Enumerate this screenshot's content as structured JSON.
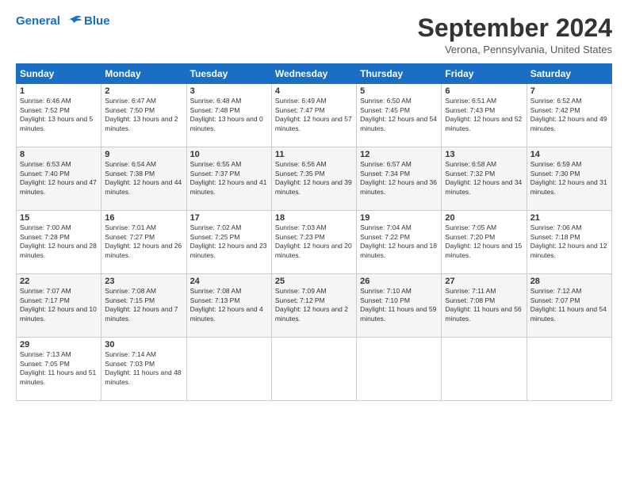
{
  "logo": {
    "line1": "General",
    "line2": "Blue"
  },
  "title": "September 2024",
  "location": "Verona, Pennsylvania, United States",
  "days_of_week": [
    "Sunday",
    "Monday",
    "Tuesday",
    "Wednesday",
    "Thursday",
    "Friday",
    "Saturday"
  ],
  "weeks": [
    [
      {
        "num": "1",
        "rise": "6:46 AM",
        "set": "7:52 PM",
        "daylight": "13 hours and 5 minutes."
      },
      {
        "num": "2",
        "rise": "6:47 AM",
        "set": "7:50 PM",
        "daylight": "13 hours and 2 minutes."
      },
      {
        "num": "3",
        "rise": "6:48 AM",
        "set": "7:48 PM",
        "daylight": "13 hours and 0 minutes."
      },
      {
        "num": "4",
        "rise": "6:49 AM",
        "set": "7:47 PM",
        "daylight": "12 hours and 57 minutes."
      },
      {
        "num": "5",
        "rise": "6:50 AM",
        "set": "7:45 PM",
        "daylight": "12 hours and 54 minutes."
      },
      {
        "num": "6",
        "rise": "6:51 AM",
        "set": "7:43 PM",
        "daylight": "12 hours and 52 minutes."
      },
      {
        "num": "7",
        "rise": "6:52 AM",
        "set": "7:42 PM",
        "daylight": "12 hours and 49 minutes."
      }
    ],
    [
      {
        "num": "8",
        "rise": "6:53 AM",
        "set": "7:40 PM",
        "daylight": "12 hours and 47 minutes."
      },
      {
        "num": "9",
        "rise": "6:54 AM",
        "set": "7:38 PM",
        "daylight": "12 hours and 44 minutes."
      },
      {
        "num": "10",
        "rise": "6:55 AM",
        "set": "7:37 PM",
        "daylight": "12 hours and 41 minutes."
      },
      {
        "num": "11",
        "rise": "6:56 AM",
        "set": "7:35 PM",
        "daylight": "12 hours and 39 minutes."
      },
      {
        "num": "12",
        "rise": "6:57 AM",
        "set": "7:34 PM",
        "daylight": "12 hours and 36 minutes."
      },
      {
        "num": "13",
        "rise": "6:58 AM",
        "set": "7:32 PM",
        "daylight": "12 hours and 34 minutes."
      },
      {
        "num": "14",
        "rise": "6:59 AM",
        "set": "7:30 PM",
        "daylight": "12 hours and 31 minutes."
      }
    ],
    [
      {
        "num": "15",
        "rise": "7:00 AM",
        "set": "7:28 PM",
        "daylight": "12 hours and 28 minutes."
      },
      {
        "num": "16",
        "rise": "7:01 AM",
        "set": "7:27 PM",
        "daylight": "12 hours and 26 minutes."
      },
      {
        "num": "17",
        "rise": "7:02 AM",
        "set": "7:25 PM",
        "daylight": "12 hours and 23 minutes."
      },
      {
        "num": "18",
        "rise": "7:03 AM",
        "set": "7:23 PM",
        "daylight": "12 hours and 20 minutes."
      },
      {
        "num": "19",
        "rise": "7:04 AM",
        "set": "7:22 PM",
        "daylight": "12 hours and 18 minutes."
      },
      {
        "num": "20",
        "rise": "7:05 AM",
        "set": "7:20 PM",
        "daylight": "12 hours and 15 minutes."
      },
      {
        "num": "21",
        "rise": "7:06 AM",
        "set": "7:18 PM",
        "daylight": "12 hours and 12 minutes."
      }
    ],
    [
      {
        "num": "22",
        "rise": "7:07 AM",
        "set": "7:17 PM",
        "daylight": "12 hours and 10 minutes."
      },
      {
        "num": "23",
        "rise": "7:08 AM",
        "set": "7:15 PM",
        "daylight": "12 hours and 7 minutes."
      },
      {
        "num": "24",
        "rise": "7:08 AM",
        "set": "7:13 PM",
        "daylight": "12 hours and 4 minutes."
      },
      {
        "num": "25",
        "rise": "7:09 AM",
        "set": "7:12 PM",
        "daylight": "12 hours and 2 minutes."
      },
      {
        "num": "26",
        "rise": "7:10 AM",
        "set": "7:10 PM",
        "daylight": "11 hours and 59 minutes."
      },
      {
        "num": "27",
        "rise": "7:11 AM",
        "set": "7:08 PM",
        "daylight": "11 hours and 56 minutes."
      },
      {
        "num": "28",
        "rise": "7:12 AM",
        "set": "7:07 PM",
        "daylight": "11 hours and 54 minutes."
      }
    ],
    [
      {
        "num": "29",
        "rise": "7:13 AM",
        "set": "7:05 PM",
        "daylight": "11 hours and 51 minutes."
      },
      {
        "num": "30",
        "rise": "7:14 AM",
        "set": "7:03 PM",
        "daylight": "11 hours and 48 minutes."
      },
      null,
      null,
      null,
      null,
      null
    ]
  ]
}
